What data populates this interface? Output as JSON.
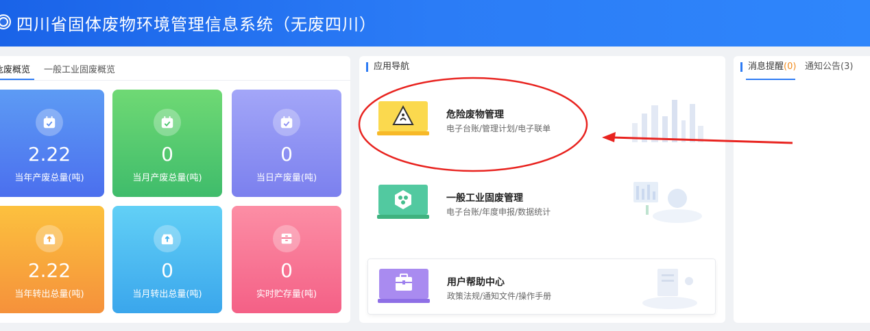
{
  "header": {
    "title": "四川省固体废物环境管理信息系统（无废四川）"
  },
  "overview": {
    "tabs": [
      {
        "label": "危废概览",
        "active": true
      },
      {
        "label": "一般工业固废概览",
        "active": false
      }
    ],
    "stats": [
      {
        "value": "2.22",
        "label": "当年产废总量(吨)",
        "color": "#4f7df0",
        "icon": "calendar-check-icon"
      },
      {
        "value": "0",
        "label": "当月产废总量(吨)",
        "color": "#46c46e",
        "icon": "calendar-check-icon"
      },
      {
        "value": "0",
        "label": "当日产废量(吨)",
        "color": "#8d8ff2",
        "icon": "calendar-check-icon"
      },
      {
        "value": "2.22",
        "label": "当年转出总量(吨)",
        "color": "#f7a53a",
        "icon": "inbox-upload-icon"
      },
      {
        "value": "0",
        "label": "当月转出总量(吨)",
        "color": "#3fb3ef",
        "icon": "inbox-upload-icon"
      },
      {
        "value": "0",
        "label": "实时贮存量(吨)",
        "color": "#f56b8a",
        "icon": "storage-box-icon"
      }
    ]
  },
  "app_nav": {
    "title": "应用导航",
    "items": [
      {
        "title": "危险废物管理",
        "subtitle": "电子台账/管理计划/电子联单",
        "icon": "hazard-warning-icon"
      },
      {
        "title": "一般工业固废管理",
        "subtitle": "电子台账/年度申报/数据统计",
        "icon": "hexagon-cluster-icon"
      },
      {
        "title": "用户帮助中心",
        "subtitle": "政策法规/通知文件/操作手册",
        "icon": "toolbox-icon"
      }
    ]
  },
  "messages": {
    "tab1_label": "消息提醒",
    "tab1_count": "(0)",
    "tab2_label": "通知公告(3)"
  },
  "colors": {
    "accent": "#2d7bf4",
    "annotation": "#e8231f",
    "header": "#2b7cf6"
  }
}
